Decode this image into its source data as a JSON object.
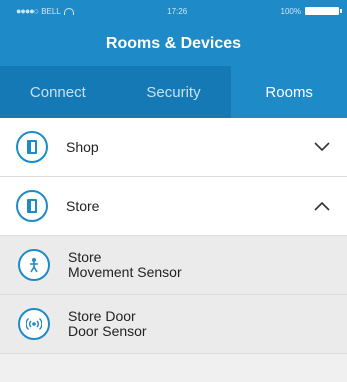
{
  "status_bar": {
    "carrier": "BELL",
    "time": "17:26",
    "battery": "100%"
  },
  "header": {
    "title": "Rooms & Devices"
  },
  "tabs": [
    {
      "label": "Connect",
      "active": false
    },
    {
      "label": "Security",
      "active": false
    },
    {
      "label": "Rooms",
      "active": true
    }
  ],
  "rooms": [
    {
      "name": "Shop",
      "icon": "door-icon",
      "expanded": false,
      "chevron": "chevron-down-icon"
    },
    {
      "name": "Store",
      "icon": "door-icon",
      "expanded": true,
      "chevron": "chevron-up-icon"
    }
  ],
  "devices": [
    {
      "line1": "Store",
      "line2": "Movement Sensor",
      "icon": "motion-person-icon"
    },
    {
      "line1": "Store Door",
      "line2": "Door Sensor",
      "icon": "wireless-signal-icon"
    }
  ],
  "colors": {
    "primary": "#1e8bc8",
    "tab_bar": "#1479b4",
    "sub_row_bg": "#ebebeb"
  }
}
